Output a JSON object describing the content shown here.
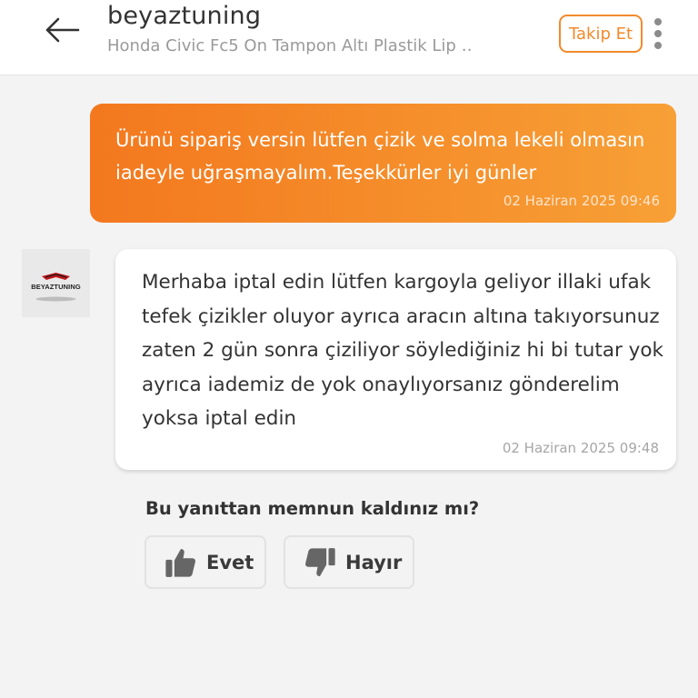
{
  "header": {
    "back_icon": "arrow-left-icon",
    "store_name": "beyaztuning",
    "product_name": "Honda Civic Fc5 On Tampon Altı Plastik Lip …",
    "follow_label": "Takip Et",
    "more_icon": "more-vertical-icon"
  },
  "messages": [
    {
      "direction": "outgoing",
      "text": "Ürünü sipariş versin lütfen çizik ve solma lekeli olmasın iadeyle uğraşmayalım.Teşekkürler iyi günler",
      "time": "02 Haziran 2025 09:46"
    },
    {
      "direction": "incoming",
      "text": "Merhaba iptal edin lütfen kargoyla geliyor illaki ufak tefek çizikler oluyor ayrıca aracın altına takıyorsunuz zaten 2 gün sonra çiziliyor söylediğiniz hi bi tutar yok ayrıca iademiz de yok onaylıyorsanız gönderelim yoksa iptal edin",
      "time": "02 Haziran 2025 09:48"
    }
  ],
  "seller_avatar": {
    "logo_text": "BEYAZTUNING",
    "logo_colors": [
      "#c0161c",
      "#1a1a1a"
    ]
  },
  "feedback": {
    "question": "Bu yanıttan memnun kaldınız mı?",
    "yes_label": "Evet",
    "no_label": "Hayır",
    "yes_icon": "thumbs-up-icon",
    "no_icon": "thumbs-down-icon"
  },
  "colors": {
    "accent": "#f28a2b",
    "bubble_gradient_start": "#f3781e",
    "bubble_gradient_end": "#f7a036",
    "background": "#f3f3f3"
  }
}
